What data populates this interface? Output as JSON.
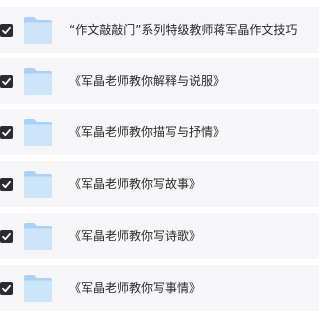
{
  "items": [
    {
      "label": "“作文敲敲门”系列特级教师蒋军晶作文技巧",
      "checked": true,
      "icon": "folder-icon"
    },
    {
      "label": "《军晶老师教你解释与说服》",
      "checked": true,
      "icon": "folder-icon"
    },
    {
      "label": "《军晶老师教你描写与抒情》",
      "checked": true,
      "icon": "folder-icon"
    },
    {
      "label": "《军晶老师教你写故事》",
      "checked": true,
      "icon": "folder-icon"
    },
    {
      "label": "《军晶老师教你写诗歌》",
      "checked": true,
      "icon": "folder-icon"
    },
    {
      "label": "《军晶老师教你写事情》",
      "checked": true,
      "icon": "folder-icon"
    }
  ],
  "colors": {
    "row_bg": "#f6f6f8",
    "checkbox": "#2b2b30",
    "folder_back": "#a9d2f6",
    "folder_front": "#cde5fb"
  }
}
